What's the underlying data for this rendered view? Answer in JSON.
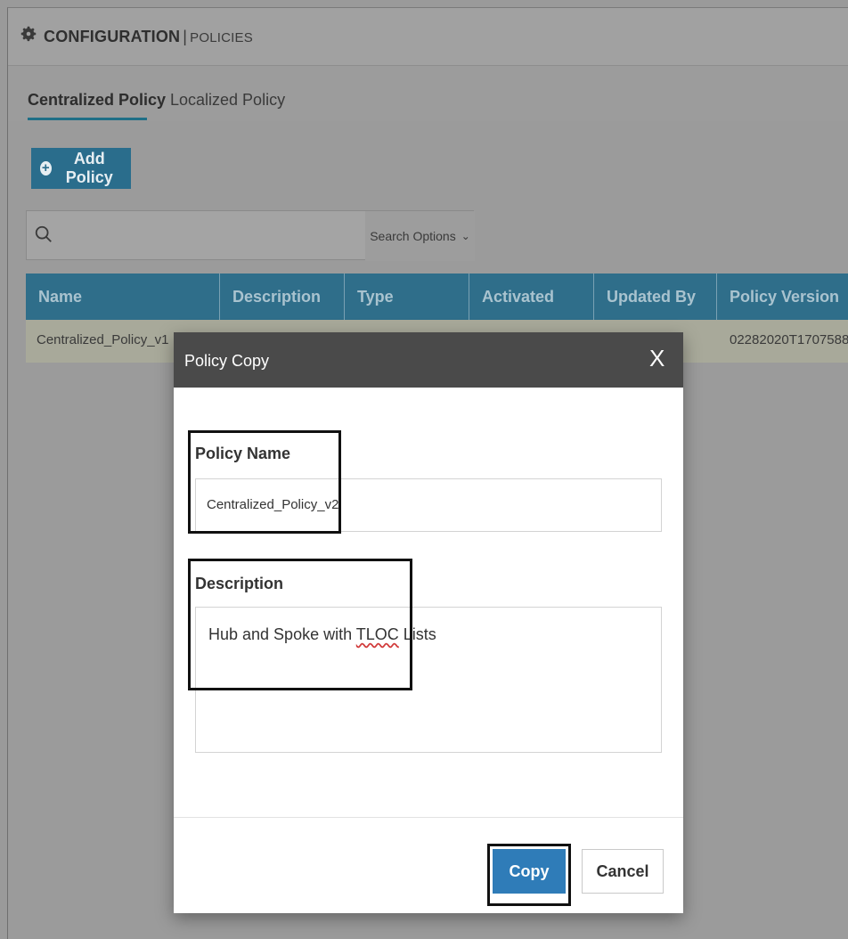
{
  "header": {
    "title": "CONFIGURATION",
    "separator": "|",
    "subtitle": "POLICIES"
  },
  "tabs": [
    {
      "label": "Centralized Policy"
    },
    {
      "label": "Localized Policy"
    }
  ],
  "toolbar": {
    "add_policy_label": "Add Policy"
  },
  "search": {
    "options_label": "Search Options"
  },
  "table": {
    "columns": [
      "Name",
      "Description",
      "Type",
      "Activated",
      "Updated By",
      "Policy Version"
    ],
    "rows": [
      {
        "name": "Centralized_Policy_v1",
        "policy_version": "02282020T1707588."
      }
    ]
  },
  "modal": {
    "title": "Policy Copy",
    "close_label": "X",
    "policy_name_label": "Policy Name",
    "policy_name_value": "Centralized_Policy_v2",
    "description_label": "Description",
    "description_value_pre": "Hub and Spoke with ",
    "description_value_mark": "TLOC",
    "description_value_post": " Lists",
    "copy_label": "Copy",
    "cancel_label": "Cancel"
  },
  "icons": [
    "gear-icon",
    "plus-circle-icon",
    "search-icon",
    "chevron-down-icon",
    "close-icon"
  ],
  "colors": {
    "accent": "#2f6e8a",
    "copy_button": "#2f7cb8",
    "modal_header": "#4a4a4a"
  }
}
